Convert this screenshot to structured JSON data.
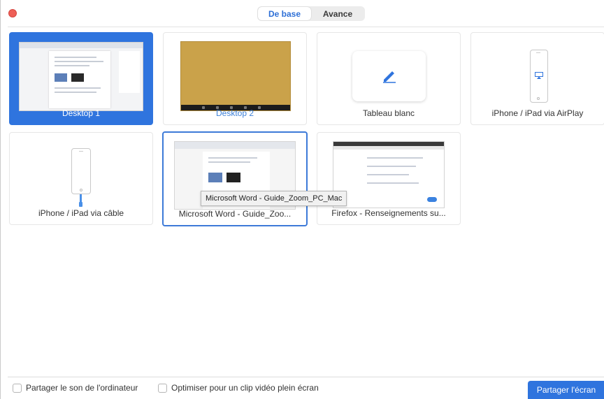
{
  "tabs": {
    "basic": "De base",
    "advanced": "Avance"
  },
  "tiles": [
    {
      "label": "Desktop 1"
    },
    {
      "label": "Desktop 2"
    },
    {
      "label": "Tableau blanc"
    },
    {
      "label": "iPhone / iPad via AirPlay"
    },
    {
      "label": "iPhone / iPad via câble"
    },
    {
      "label": "Microsoft Word - Guide_Zoo..."
    },
    {
      "label": "Firefox - Renseignements su..."
    }
  ],
  "tooltip": "Microsoft Word - Guide_Zoom_PC_Mac",
  "footer": {
    "share_sound": "Partager le son de l'ordinateur",
    "optimize_video": "Optimiser pour un clip vidéo plein écran",
    "share_button": "Partager l'écran"
  },
  "colors": {
    "accent": "#2f74de",
    "close": "#ee5f57"
  }
}
